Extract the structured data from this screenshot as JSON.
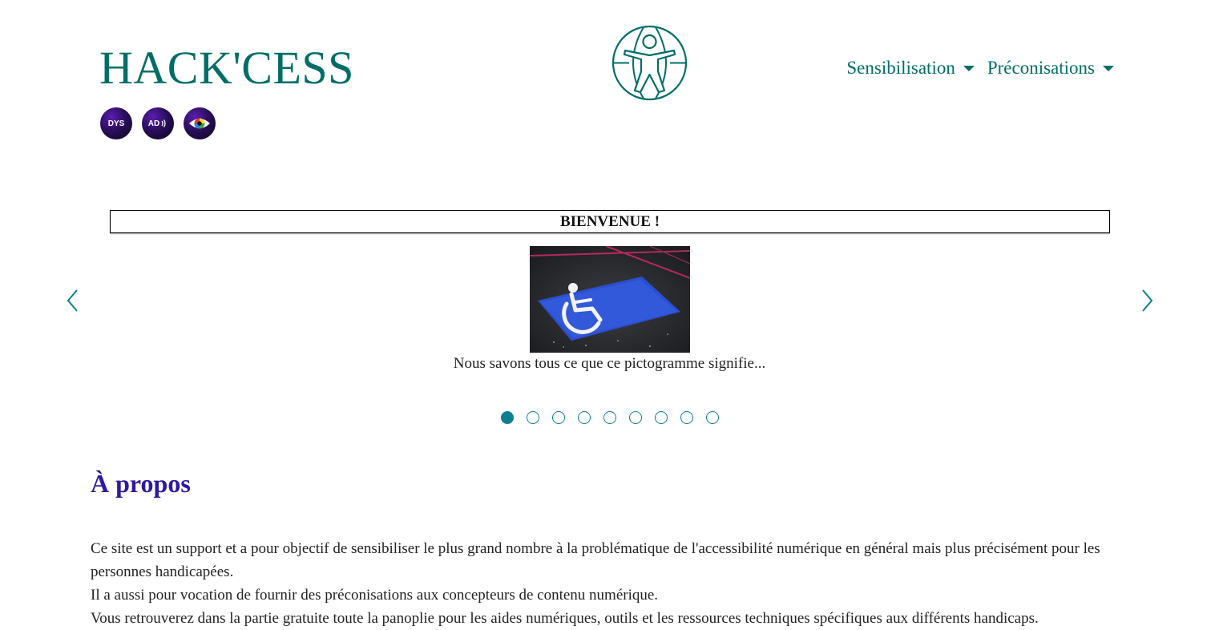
{
  "header": {
    "site_title": "HACK'CESS",
    "accessibility_tools": [
      {
        "label": "DYS",
        "icon": "dyslexia-icon"
      },
      {
        "label": "AD",
        "icon": "audio-description-icon"
      },
      {
        "label": "",
        "icon": "color-vision-eye-icon"
      }
    ],
    "logo_icon": "universal-access-globe-icon"
  },
  "nav": {
    "items": [
      {
        "label": "Sensibilisation"
      },
      {
        "label": "Préconisations"
      }
    ]
  },
  "carousel": {
    "title": "BIENVENUE !",
    "caption": "Nous savons tous ce que ce pictogramme signifie...",
    "image_icon": "wheelchair-parking-photo",
    "slide_count": 9,
    "active_index": 0
  },
  "about": {
    "heading": "À propos",
    "paragraphs": [
      "Ce site est un support et a pour objectif de sensibiliser le plus grand nombre à la problématique de l'accessibilité numérique en général mais plus précisément pour les personnes handicapées.",
      "Il a aussi pour vocation de fournir des  préconisations aux concepteurs de contenu numérique.",
      "Vous retrouverez dans la partie gratuite toute la panoplie pour les aides numériques, outils et les ressources techniques spécifiques aux différents handicaps."
    ]
  },
  "colors": {
    "brand_teal": "#006e66",
    "indicator_teal": "#0e7f93",
    "heading_purple": "#2c1aa0"
  }
}
